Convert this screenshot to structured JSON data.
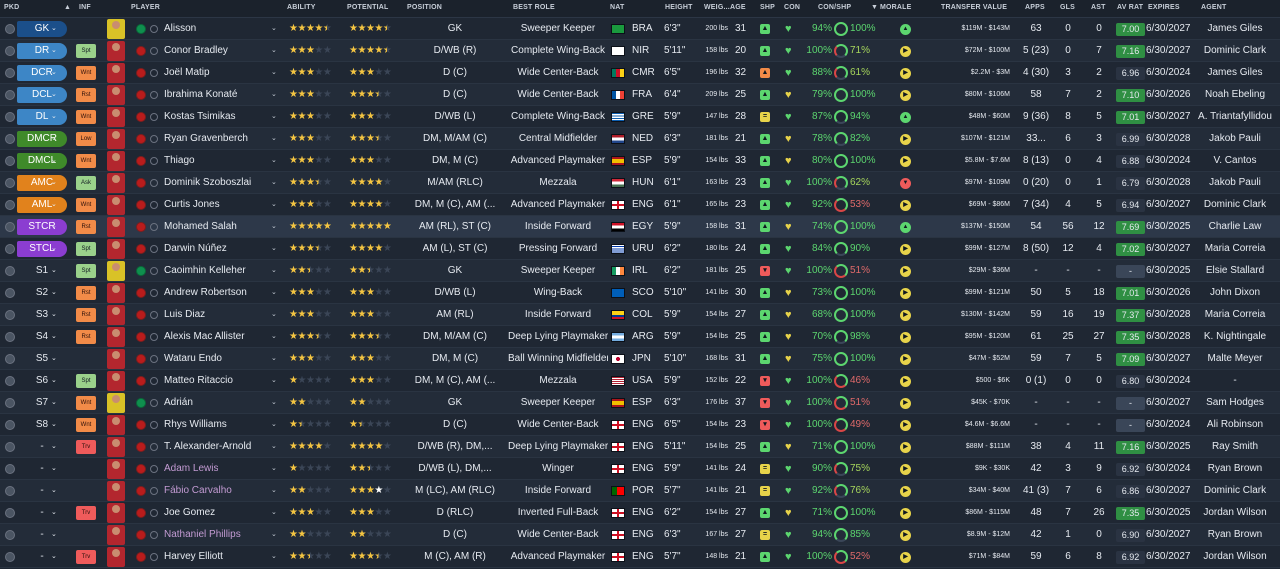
{
  "headers": {
    "pkd": "PKD",
    "inf": "INF",
    "player": "PLAYER",
    "ability": "ABILITY",
    "potential": "POTENTIAL",
    "position": "POSITION",
    "best_role": "BEST ROLE",
    "nat": "NAT",
    "height": "HEIGHT",
    "weight": "WEIG...",
    "age": "AGE",
    "shp": "SHP",
    "con": "CON",
    "con_shp": "CON/SHP",
    "morale": "MORALE",
    "transfer_value": "TRANSFER VALUE",
    "apps": "APPS",
    "gls": "GLS",
    "ast": "AST",
    "av_rat": "AV RAT",
    "expires": "EXPIRES",
    "agent": "AGENT"
  },
  "colors": {
    "gk": "#1b4f8a",
    "d": "#3d86c6",
    "dm": "#3f8a2a",
    "m": "#e1821c",
    "am": "#e1821c",
    "st": "#8b3dd1",
    "inf_green": "#9ad18b",
    "inf_orange": "#f28b48",
    "inf_red": "#ef5b5b",
    "rating_green": "#2f8f43"
  },
  "players": [
    {
      "pkd": "GK",
      "pk": "gk",
      "inf": "",
      "name": "Alisson",
      "gk": true,
      "ab": 4.5,
      "pot": 4.5,
      "position": "GK",
      "role": "Sweeper Keeper",
      "flag": "BR",
      "nat": "BRA",
      "height": "6'3\"",
      "weight": "200 lbs",
      "age": "31",
      "shp": "up",
      "con": "heart",
      "cp": "94%",
      "sp": "100%",
      "mor": "up",
      "tv": "$119M - $143M",
      "apps": "63",
      "gls": "0",
      "ast": "0",
      "av": "7.00",
      "avc": "g",
      "exp": "6/30/2027",
      "agent": "James Giles"
    },
    {
      "pkd": "DR",
      "pk": "d",
      "inf": "Spt",
      "ic": "g",
      "name": "Conor Bradley",
      "ab": 3,
      "pot": 4.5,
      "pw": true,
      "position": "D/WB (R)",
      "role": "Complete Wing-Back",
      "flag": "NI",
      "nat": "NIR",
      "height": "5'11\"",
      "weight": "158 lbs",
      "age": "20",
      "shp": "up",
      "con": "heart",
      "cp": "100%",
      "sp": "71%",
      "mor": "right",
      "tv": "$72M - $100M",
      "apps": "5 (23)",
      "gls": "0",
      "ast": "7",
      "av": "7.16",
      "avc": "g",
      "exp": "6/30/2027",
      "agent": "Dominic Clark"
    },
    {
      "pkd": "DCR",
      "pk": "d",
      "inf": "Wnt",
      "ic": "o",
      "name": "Joël Matip",
      "ab": 3,
      "pot": 3,
      "position": "D (C)",
      "role": "Wide Center-Back",
      "flag": "CM",
      "nat": "CMR",
      "height": "6'5\"",
      "weight": "196 lbs",
      "age": "32",
      "shp": "upo",
      "con": "heart",
      "cp": "88%",
      "sp": "61%",
      "mor": "right",
      "tv": "$2.2M - $3M",
      "apps": "4 (30)",
      "gls": "3",
      "ast": "2",
      "av": "6.96",
      "avc": "n",
      "exp": "6/30/2024",
      "agent": "James Giles"
    },
    {
      "pkd": "DCL",
      "pk": "d",
      "inf": "Rst",
      "ic": "o",
      "name": "Ibrahima Konaté",
      "ab": 3,
      "pot": 3.5,
      "position": "D (C)",
      "role": "Wide Center-Back",
      "flag": "FR",
      "nat": "FRA",
      "height": "6'4\"",
      "weight": "209 lbs",
      "age": "25",
      "shp": "up",
      "con": "heartY",
      "cp": "79%",
      "sp": "100%",
      "mor": "right",
      "tv": "$80M - $106M",
      "apps": "58",
      "gls": "7",
      "ast": "2",
      "av": "7.10",
      "avc": "g",
      "exp": "6/30/2026",
      "agent": "Noah Ebeling"
    },
    {
      "pkd": "DL",
      "pk": "d",
      "inf": "Wnt",
      "ic": "o",
      "name": "Kostas Tsimikas",
      "ab": 3,
      "pot": 3,
      "position": "D/WB (L)",
      "role": "Complete Wing-Back",
      "flag": "GR",
      "nat": "GRE",
      "height": "5'9\"",
      "weight": "147 lbs",
      "age": "28",
      "shp": "eq",
      "con": "heart",
      "cp": "87%",
      "sp": "94%",
      "mor": "up",
      "tv": "$48M - $60M",
      "apps": "9 (36)",
      "gls": "8",
      "ast": "5",
      "av": "7.01",
      "avc": "g",
      "exp": "6/30/2027",
      "agent": "A. Triantafyllidou"
    },
    {
      "pkd": "DMCR",
      "pk": "dm",
      "inf": "Low",
      "ic": "o",
      "name": "Ryan Gravenberch",
      "ab": 3,
      "pot": 3.5,
      "position": "DM, M/AM (C)",
      "role": "Central Midfielder",
      "flag": "NL",
      "nat": "NED",
      "height": "6'3\"",
      "weight": "181 lbs",
      "age": "21",
      "shp": "up",
      "con": "heartY",
      "cp": "78%",
      "sp": "82%",
      "mor": "right",
      "tv": "$107M - $121M",
      "apps": "33...",
      "gls": "6",
      "ast": "3",
      "av": "6.99",
      "avc": "n",
      "exp": "6/30/2028",
      "agent": "Jakob Pauli"
    },
    {
      "pkd": "DMCL",
      "pk": "dm",
      "inf": "Wnt",
      "ic": "o",
      "name": "Thiago",
      "ab": 3,
      "pot": 3,
      "position": "DM, M (C)",
      "role": "Advanced Playmaker",
      "flag": "ES",
      "nat": "ESP",
      "height": "5'9\"",
      "weight": "154 lbs",
      "age": "33",
      "shp": "up",
      "con": "heartY",
      "cp": "80%",
      "sp": "100%",
      "mor": "right",
      "tv": "$5.8M - $7.6M",
      "apps": "8 (13)",
      "gls": "0",
      "ast": "4",
      "av": "6.88",
      "avc": "n",
      "exp": "6/30/2024",
      "agent": "V. Cantos"
    },
    {
      "pkd": "AMC",
      "pk": "am",
      "inf": "Ask",
      "ic": "g",
      "name": "Dominik Szoboszlai",
      "ab": 3.5,
      "pot": 4,
      "position": "M/AM (RLC)",
      "role": "Mezzala",
      "flag": "HU",
      "nat": "HUN",
      "height": "6'1\"",
      "weight": "163 lbs",
      "age": "23",
      "shp": "up",
      "con": "heart",
      "cp": "100%",
      "sp": "62%",
      "mor": "down",
      "tv": "$97M - $109M",
      "apps": "0 (20)",
      "gls": "0",
      "ast": "1",
      "av": "6.79",
      "avc": "n",
      "exp": "6/30/2028",
      "agent": "Jakob Pauli"
    },
    {
      "pkd": "AML",
      "pk": "am",
      "inf": "Wnt",
      "ic": "o",
      "name": "Curtis Jones",
      "ab": 3,
      "pot": 4,
      "position": "DM, M (C), AM (...",
      "role": "Advanced Playmaker",
      "flag": "EN",
      "nat": "ENG",
      "height": "6'1\"",
      "weight": "165 lbs",
      "age": "23",
      "shp": "up",
      "con": "heart",
      "cp": "92%",
      "sp": "53%",
      "mor": "right",
      "tv": "$69M - $86M",
      "apps": "7 (34)",
      "gls": "4",
      "ast": "5",
      "av": "6.94",
      "avc": "n",
      "exp": "6/30/2027",
      "agent": "Dominic Clark"
    },
    {
      "pkd": "STCR",
      "pk": "st",
      "inf": "Rst",
      "ic": "o",
      "name": "Mohamed Salah",
      "ab": 5,
      "pot": 5,
      "position": "AM (RL), ST (C)",
      "role": "Inside Forward",
      "flag": "EG",
      "nat": "EGY",
      "height": "5'9\"",
      "weight": "158 lbs",
      "age": "31",
      "shp": "up",
      "con": "heartY",
      "cp": "74%",
      "sp": "100%",
      "mor": "up",
      "tv": "$137M - $150M",
      "apps": "54",
      "gls": "56",
      "ast": "12",
      "av": "7.69",
      "avc": "g",
      "exp": "6/30/2025",
      "agent": "Charlie Law",
      "sel": true
    },
    {
      "pkd": "STCL",
      "pk": "st",
      "inf": "Spt",
      "ic": "g",
      "name": "Darwin Núñez",
      "ab": 3.5,
      "pot": 4,
      "position": "AM (L), ST (C)",
      "role": "Pressing Forward",
      "flag": "UY",
      "nat": "URU",
      "height": "6'2\"",
      "weight": "180 lbs",
      "age": "24",
      "shp": "up",
      "con": "heart",
      "cp": "84%",
      "sp": "90%",
      "mor": "right",
      "tv": "$99M - $127M",
      "apps": "8 (50)",
      "gls": "12",
      "ast": "4",
      "av": "7.02",
      "avc": "g",
      "exp": "6/30/2027",
      "agent": "Maria Correia"
    },
    {
      "pkd": "S1",
      "pk": "",
      "inf": "Spt",
      "ic": "g",
      "name": "Caoimhin Kelleher",
      "gk": true,
      "ab": 2.5,
      "pot": 2.5,
      "position": "GK",
      "role": "Sweeper Keeper",
      "flag": "IE",
      "nat": "IRL",
      "height": "6'2\"",
      "weight": "181 lbs",
      "age": "25",
      "shp": "red",
      "con": "heart",
      "cp": "100%",
      "sp": "51%",
      "mor": "right",
      "tv": "$29M - $36M",
      "apps": "-",
      "gls": "-",
      "ast": "-",
      "av": "-",
      "avc": "n",
      "exp": "6/30/2025",
      "agent": "Elsie Stallard"
    },
    {
      "pkd": "S2",
      "pk": "",
      "inf": "Rst",
      "ic": "o",
      "name": "Andrew Robertson",
      "ab": 3,
      "pot": 3,
      "position": "D/WB (L)",
      "role": "Wing-Back",
      "flag": "SC",
      "nat": "SCO",
      "height": "5'10\"",
      "weight": "141 lbs",
      "age": "30",
      "shp": "up",
      "con": "heartY",
      "cp": "73%",
      "sp": "100%",
      "mor": "right",
      "tv": "$99M - $121M",
      "apps": "50",
      "gls": "5",
      "ast": "18",
      "av": "7.01",
      "avc": "g",
      "exp": "6/30/2026",
      "agent": "John Dixon"
    },
    {
      "pkd": "S3",
      "pk": "",
      "inf": "Rst",
      "ic": "o",
      "name": "Luis Diaz",
      "ab": 3,
      "pot": 3,
      "position": "AM (RL)",
      "role": "Inside Forward",
      "flag": "CO",
      "nat": "COL",
      "height": "5'9\"",
      "weight": "154 lbs",
      "age": "27",
      "shp": "up",
      "con": "heartY",
      "cp": "68%",
      "sp": "100%",
      "mor": "right",
      "tv": "$130M - $142M",
      "apps": "59",
      "gls": "16",
      "ast": "19",
      "av": "7.37",
      "avc": "g",
      "exp": "6/30/2028",
      "agent": "Maria Correia"
    },
    {
      "pkd": "S4",
      "pk": "",
      "inf": "Rst",
      "ic": "o",
      "name": "Alexis Mac Allister",
      "ab": 3.5,
      "pot": 3.5,
      "position": "DM, M/AM (C)",
      "role": "Deep Lying Playmaker",
      "flag": "AR",
      "nat": "ARG",
      "height": "5'9\"",
      "weight": "154 lbs",
      "age": "25",
      "shp": "up",
      "con": "heartY",
      "cp": "70%",
      "sp": "98%",
      "mor": "right",
      "tv": "$95M - $120M",
      "apps": "61",
      "gls": "25",
      "ast": "27",
      "av": "7.35",
      "avc": "g",
      "exp": "6/30/2028",
      "agent": "K. Nightingale"
    },
    {
      "pkd": "S5",
      "pk": "",
      "inf": "",
      "name": "Wataru Endo",
      "ab": 3,
      "pot": 3,
      "position": "DM, M (C)",
      "role": "Ball Winning Midfielder",
      "flag": "JP",
      "nat": "JPN",
      "height": "5'10\"",
      "weight": "168 lbs",
      "age": "31",
      "shp": "up",
      "con": "heartY",
      "cp": "75%",
      "sp": "100%",
      "mor": "right",
      "tv": "$47M - $52M",
      "apps": "59",
      "gls": "7",
      "ast": "5",
      "av": "7.09",
      "avc": "g",
      "exp": "6/30/2027",
      "agent": "Malte Meyer"
    },
    {
      "pkd": "S6",
      "pk": "",
      "inf": "Spt",
      "ic": "g",
      "name": "Matteo Ritaccio",
      "ab": 1,
      "pot": 3,
      "position": "DM, M (C), AM (...",
      "role": "Mezzala",
      "flag": "US",
      "nat": "USA",
      "height": "5'9\"",
      "weight": "152 lbs",
      "age": "22",
      "shp": "red",
      "con": "heart",
      "cp": "100%",
      "sp": "46%",
      "mor": "right",
      "tv": "$500 - $6K",
      "apps": "0 (1)",
      "gls": "0",
      "ast": "0",
      "av": "6.80",
      "avc": "n",
      "exp": "6/30/2024",
      "agent": "-"
    },
    {
      "pkd": "S7",
      "pk": "",
      "inf": "Wnt",
      "ic": "o",
      "name": "Adrián",
      "gk": true,
      "ab": 2,
      "pot": 2,
      "position": "GK",
      "role": "Sweeper Keeper",
      "flag": "ES",
      "nat": "ESP",
      "height": "6'3\"",
      "weight": "176 lbs",
      "age": "37",
      "shp": "red",
      "con": "heart",
      "cp": "100%",
      "sp": "51%",
      "mor": "right",
      "tv": "$45K - $70K",
      "apps": "-",
      "gls": "-",
      "ast": "-",
      "av": "-",
      "avc": "n",
      "exp": "6/30/2027",
      "agent": "Sam Hodges"
    },
    {
      "pkd": "S8",
      "pk": "",
      "inf": "Wnt",
      "ic": "o",
      "name": "Rhys Williams",
      "ab": 1.5,
      "pot": 1.5,
      "position": "D (C)",
      "role": "Wide Center-Back",
      "flag": "EN",
      "nat": "ENG",
      "height": "6'5\"",
      "weight": "154 lbs",
      "age": "23",
      "shp": "red",
      "con": "heart",
      "cp": "100%",
      "sp": "49%",
      "mor": "right",
      "tv": "$4.6M - $6.6M",
      "apps": "-",
      "gls": "-",
      "ast": "-",
      "av": "-",
      "avc": "n",
      "exp": "6/30/2024",
      "agent": "Ali Robinson"
    },
    {
      "pkd": "-",
      "pk": "",
      "inf": "Trv",
      "ic": "r",
      "name": "T. Alexander-Arnold",
      "ab": 4,
      "pot": 4,
      "position": "D/WB (R), DM,...",
      "role": "Deep Lying Playmaker",
      "flag": "EN",
      "nat": "ENG",
      "height": "5'11\"",
      "weight": "154 lbs",
      "age": "25",
      "shp": "up",
      "con": "heartY",
      "cp": "71%",
      "sp": "100%",
      "mor": "right",
      "tv": "$88M - $111M",
      "apps": "38",
      "gls": "4",
      "ast": "11",
      "av": "7.16",
      "avc": "g",
      "exp": "6/30/2025",
      "agent": "Ray Smith"
    },
    {
      "pkd": "-",
      "pk": "",
      "inf": "",
      "name": "Adam Lewis",
      "loan": true,
      "ab": 1,
      "pot": 2.5,
      "position": "D/WB (L), DM,...",
      "role": "Winger",
      "flag": "EN",
      "nat": "ENG",
      "height": "5'9\"",
      "weight": "141 lbs",
      "age": "24",
      "shp": "eq",
      "con": "heart",
      "cp": "90%",
      "sp": "75%",
      "mor": "right",
      "tv": "$9K - $30K",
      "apps": "42",
      "gls": "3",
      "ast": "9",
      "av": "6.92",
      "avc": "n",
      "exp": "6/30/2024",
      "agent": "Ryan Brown"
    },
    {
      "pkd": "-",
      "pk": "",
      "inf": "",
      "name": "Fábio Carvalho",
      "loan": true,
      "ab": 2,
      "pot": 3,
      "pw": true,
      "position": "M (LC), AM (RLC)",
      "role": "Inside Forward",
      "flag": "PT",
      "nat": "POR",
      "height": "5'7\"",
      "weight": "141 lbs",
      "age": "21",
      "shp": "eq",
      "con": "heart",
      "cp": "92%",
      "sp": "76%",
      "mor": "right",
      "tv": "$34M - $40M",
      "apps": "41 (3)",
      "gls": "7",
      "ast": "6",
      "av": "6.86",
      "avc": "n",
      "exp": "6/30/2027",
      "agent": "Dominic Clark"
    },
    {
      "pkd": "-",
      "pk": "",
      "inf": "Trv",
      "ic": "r",
      "name": "Joe Gomez",
      "ab": 3,
      "pot": 3,
      "position": "D (RLC)",
      "role": "Inverted Full-Back",
      "flag": "EN",
      "nat": "ENG",
      "height": "6'2\"",
      "weight": "154 lbs",
      "age": "27",
      "shp": "up",
      "con": "heartY",
      "cp": "71%",
      "sp": "100%",
      "mor": "right",
      "tv": "$86M - $115M",
      "apps": "48",
      "gls": "7",
      "ast": "26",
      "av": "7.35",
      "avc": "g",
      "exp": "6/30/2025",
      "agent": "Jordan Wilson"
    },
    {
      "pkd": "-",
      "pk": "",
      "inf": "",
      "name": "Nathaniel Phillips",
      "loan": true,
      "ab": 2,
      "pot": 2,
      "position": "D (C)",
      "role": "Wide Center-Back",
      "flag": "EN",
      "nat": "ENG",
      "height": "6'3\"",
      "weight": "167 lbs",
      "age": "27",
      "shp": "eq",
      "con": "heart",
      "cp": "94%",
      "sp": "85%",
      "mor": "right",
      "tv": "$8.9M - $12M",
      "apps": "42",
      "gls": "1",
      "ast": "0",
      "av": "6.90",
      "avc": "n",
      "exp": "6/30/2027",
      "agent": "Ryan Brown"
    },
    {
      "pkd": "-",
      "pk": "",
      "inf": "Trv",
      "ic": "r",
      "name": "Harvey Elliott",
      "ab": 2.5,
      "pot": 3.5,
      "position": "M (C), AM (R)",
      "role": "Advanced Playmaker",
      "flag": "EN",
      "nat": "ENG",
      "height": "5'7\"",
      "weight": "148 lbs",
      "age": "21",
      "shp": "up",
      "con": "heart",
      "cp": "100%",
      "sp": "52%",
      "mor": "right",
      "tv": "$71M - $84M",
      "apps": "59",
      "gls": "6",
      "ast": "8",
      "av": "6.92",
      "avc": "n",
      "exp": "6/30/2027",
      "agent": "Jordan Wilson"
    }
  ]
}
